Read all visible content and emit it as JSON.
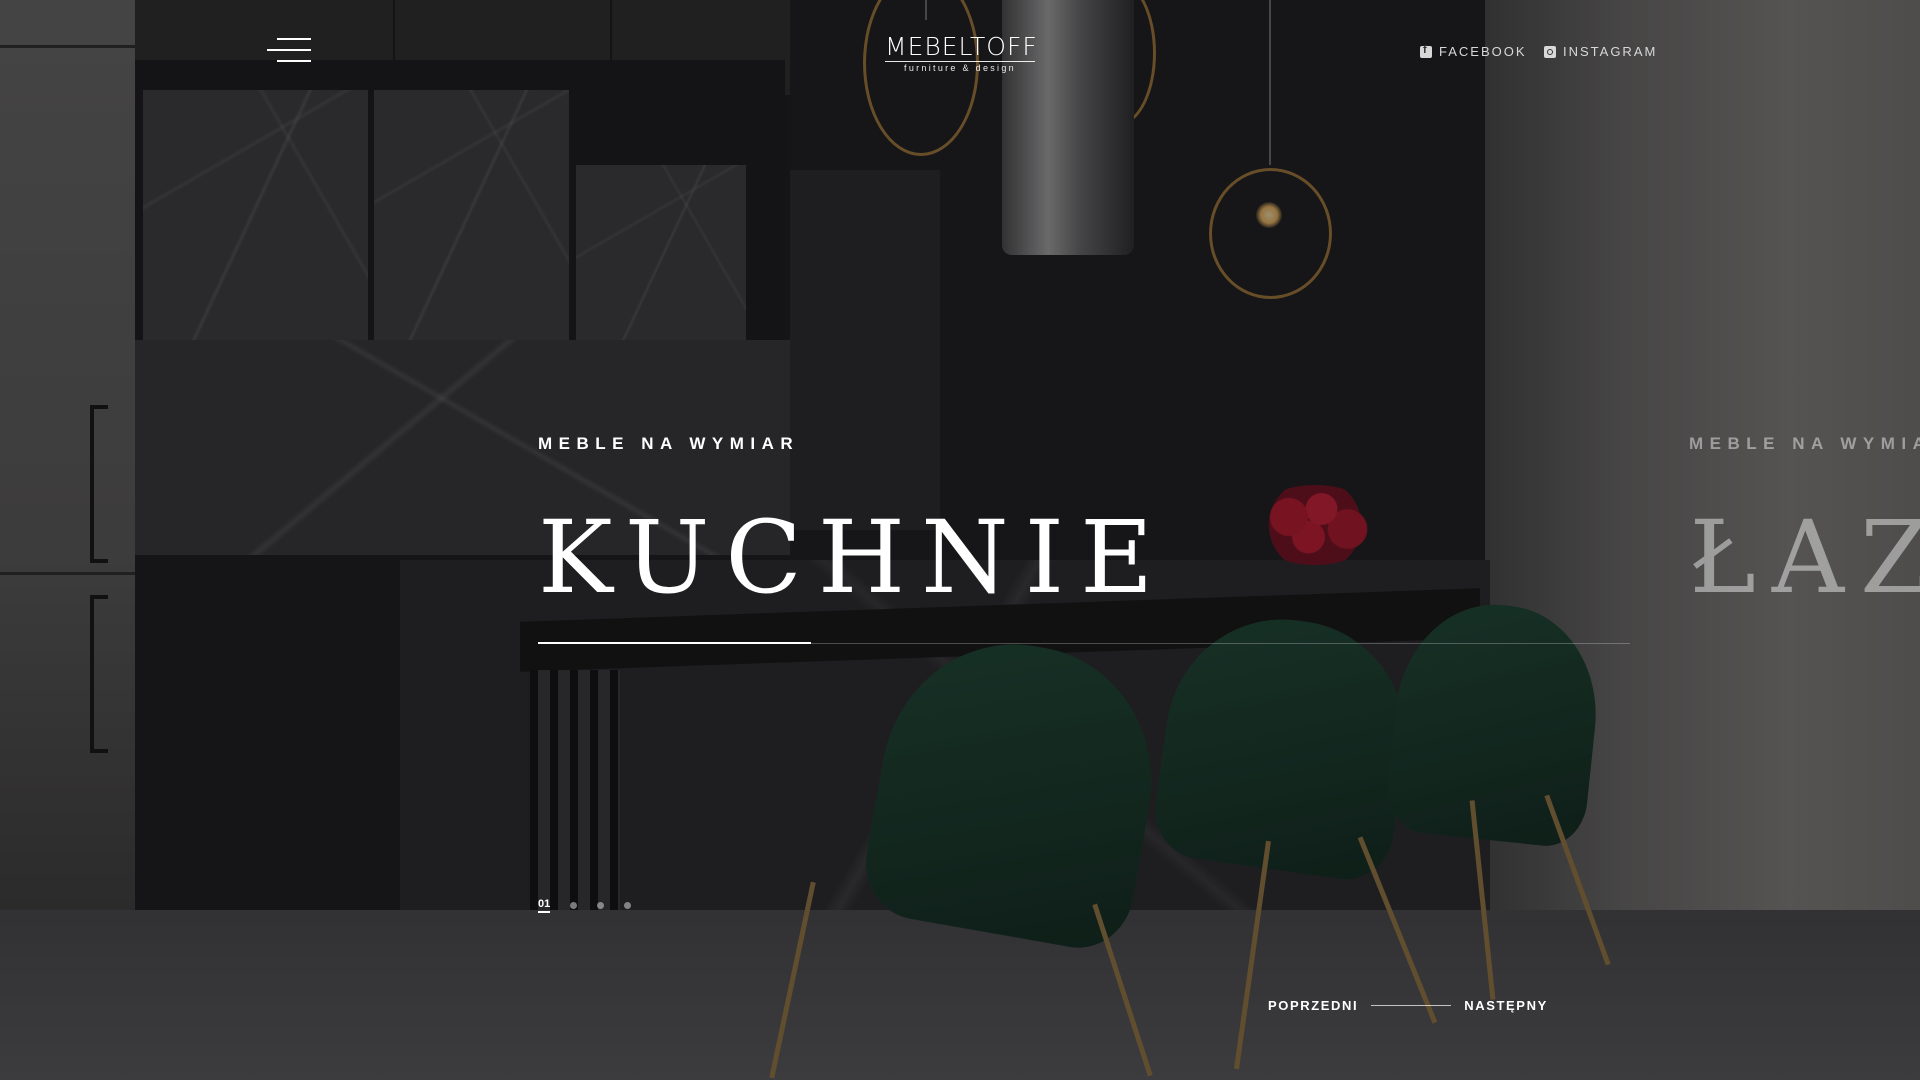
{
  "brand": {
    "name": "MEBELTOFF",
    "tagline": "furniture & design"
  },
  "header": {
    "social": [
      {
        "label": "FACEBOOK",
        "icon": "facebook-icon"
      },
      {
        "label": "INSTAGRAM",
        "icon": "instagram-icon"
      }
    ]
  },
  "slides": [
    {
      "eyebrow": "MEBLE NA WYMIAR",
      "title": "KUCHNIE"
    },
    {
      "eyebrow": "MEBLE NA WYMIA",
      "title": "ŁAZ"
    }
  ],
  "slider": {
    "current_index": "01",
    "dots_count": 3,
    "progress_fraction": 0.25
  },
  "nav": {
    "prev_label": "POPRZEDNI",
    "next_label": "NASTĘPNY"
  }
}
